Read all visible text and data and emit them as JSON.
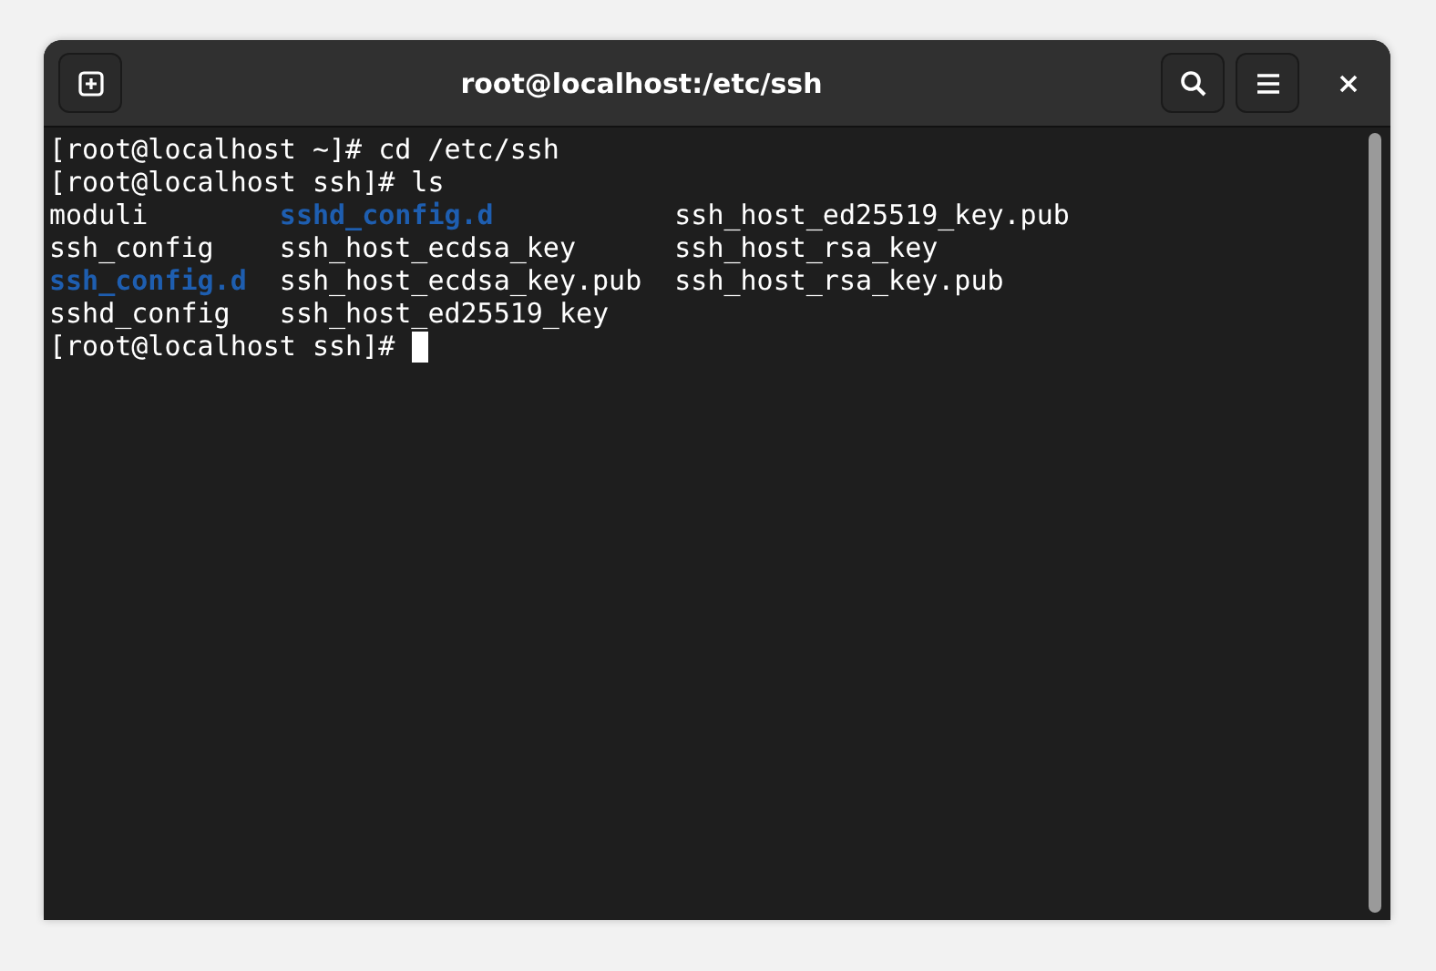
{
  "window": {
    "title": "root@localhost:/etc/ssh"
  },
  "terminal": {
    "lines": [
      {
        "kind": "command",
        "text": "[root@localhost ~]# cd /etc/ssh"
      },
      {
        "kind": "command",
        "text": "[root@localhost ssh]# ls"
      },
      {
        "kind": "listing",
        "cells": [
          {
            "text": "moduli",
            "kind": "file"
          },
          {
            "text": "sshd_config.d",
            "kind": "dir"
          },
          {
            "text": "ssh_host_ed25519_key.pub",
            "kind": "file"
          }
        ]
      },
      {
        "kind": "listing",
        "cells": [
          {
            "text": "ssh_config",
            "kind": "file"
          },
          {
            "text": "ssh_host_ecdsa_key",
            "kind": "file"
          },
          {
            "text": "ssh_host_rsa_key",
            "kind": "file"
          }
        ]
      },
      {
        "kind": "listing",
        "cells": [
          {
            "text": "ssh_config.d",
            "kind": "dir"
          },
          {
            "text": "ssh_host_ecdsa_key.pub",
            "kind": "file"
          },
          {
            "text": "ssh_host_rsa_key.pub",
            "kind": "file"
          }
        ]
      },
      {
        "kind": "listing",
        "cells": [
          {
            "text": "sshd_config",
            "kind": "file"
          },
          {
            "text": "ssh_host_ed25519_key",
            "kind": "file"
          }
        ]
      },
      {
        "kind": "prompt",
        "text": "[root@localhost ssh]#"
      }
    ]
  }
}
